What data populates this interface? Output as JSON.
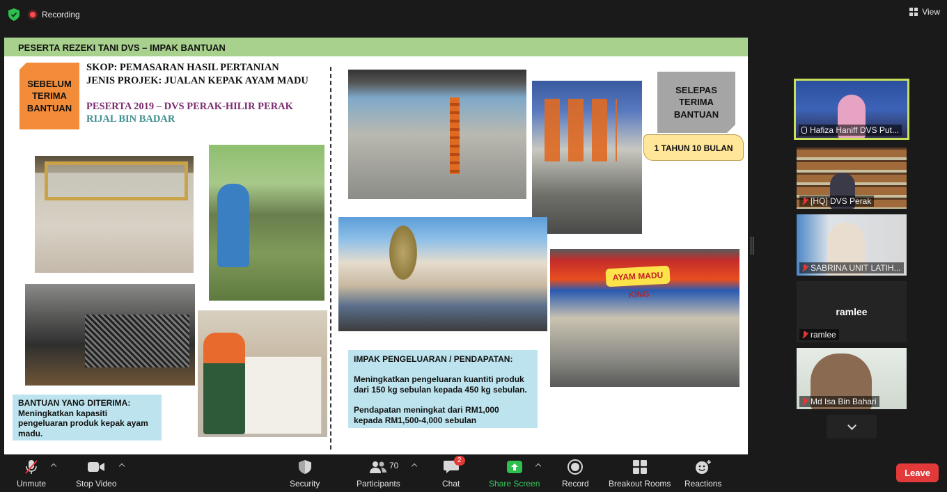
{
  "topbar": {
    "recording_label": "Recording",
    "view_label": "View"
  },
  "slide": {
    "header": "PESERTA REZEKI TANI DVS – IMPAK BANTUAN",
    "before_badge": "SEBELUM TERIMA BANTUAN",
    "skop": "SKOP:  PEMASARAN HASIL PERTANIAN",
    "jenis": "JENIS PROJEK: JUALAN KEPAK AYAM MADU",
    "peserta": "PESERTA 2019 – DVS PERAK-HILIR PERAK",
    "nama": "RIJAL BIN BADAR",
    "after_badge": "SELEPAS TERIMA BANTUAN",
    "duration": "1 TAHUN 10 BULAN",
    "kiosk_sign": "AYAM MADU KING",
    "bantuan_title": "BANTUAN YANG DITERIMA:",
    "bantuan_body": "Meningkatkan kapasiti pengeluaran produk kepak ayam madu.",
    "impak_title": "IMPAK PENGELUARAN / PENDAPATAN:",
    "impak_line1": "Meningkatkan pengeluaran kuantiti produk dari 150 kg sebulan kepada 450 kg sebulan.",
    "impak_line2a": "Pendapatan meningkat dari RM1,000",
    "impak_line2b": "kepada RM1,500-4,000 sebulan"
  },
  "participants": [
    {
      "name": "Hafiza Haniff DVS Put...",
      "active": true
    },
    {
      "name": "[HQ] DVS Perak"
    },
    {
      "name": "SABRINA UNIT LATIH..."
    },
    {
      "name": "ramlee",
      "display": "ramlee"
    },
    {
      "name": "Md Isa Bin Bahari"
    }
  ],
  "toolbar": {
    "unmute": "Unmute",
    "stop_video": "Stop Video",
    "security": "Security",
    "participants": "Participants",
    "participants_count": "70",
    "chat": "Chat",
    "chat_badge": "2",
    "share_screen": "Share Screen",
    "record": "Record",
    "breakout": "Breakout Rooms",
    "reactions": "Reactions",
    "leave": "Leave"
  },
  "colors": {
    "accent_green": "#3ac85c",
    "leave_red": "#e23a3a",
    "header_green": "#a9d18e",
    "active_border": "#c6e05a"
  }
}
